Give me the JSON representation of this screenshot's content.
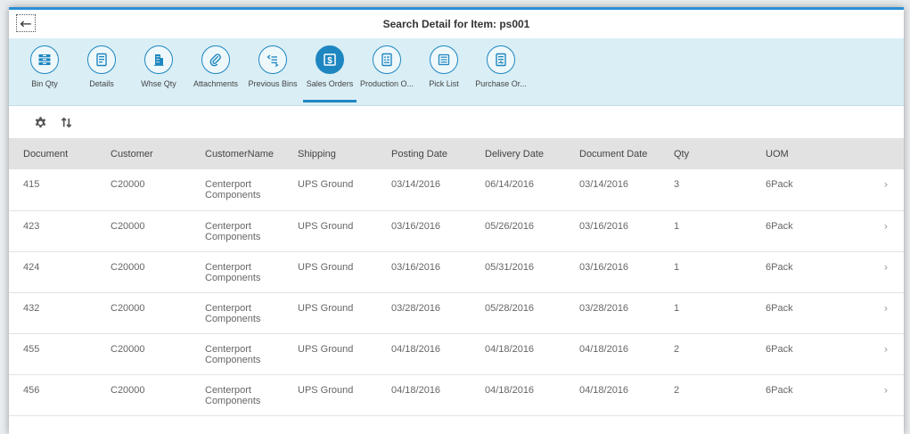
{
  "window": {
    "title": "Search Detail for Item: ps001"
  },
  "toolbar": {
    "back_icon": "arrow-left-icon",
    "tabs": [
      {
        "label": "Bin Qty",
        "icon": "bin-stack-icon"
      },
      {
        "label": "Details",
        "icon": "details-doc-icon"
      },
      {
        "label": "Whse Qty",
        "icon": "warehouse-building-icon"
      },
      {
        "label": "Attachments",
        "icon": "paperclip-icon"
      },
      {
        "label": "Previous Bins",
        "icon": "previous-list-icon"
      },
      {
        "label": "Sales Orders",
        "icon": "dollar-doc-icon",
        "active": true
      },
      {
        "label": "Production O...",
        "icon": "production-doc-icon"
      },
      {
        "label": "Pick List",
        "icon": "list-icon"
      },
      {
        "label": "Purchase Or...",
        "icon": "purchase-doc-icon"
      }
    ]
  },
  "tools": {
    "settings_icon": "gear-icon",
    "sort_icon": "sort-arrows-icon"
  },
  "table": {
    "columns": [
      "Document",
      "Customer",
      "CustomerName",
      "Shipping",
      "Posting Date",
      "Delivery Date",
      "Document Date",
      "Qty",
      "UOM"
    ],
    "rows": [
      {
        "document": "415",
        "customer": "C20000",
        "customer_name_1": "Centerport",
        "customer_name_2": "Components",
        "shipping": "UPS Ground",
        "posting_date": "03/14/2016",
        "delivery_date": "06/14/2016",
        "document_date": "03/14/2016",
        "qty": "3",
        "uom": "6Pack"
      },
      {
        "document": "423",
        "customer": "C20000",
        "customer_name_1": "Centerport",
        "customer_name_2": "Components",
        "shipping": "UPS Ground",
        "posting_date": "03/16/2016",
        "delivery_date": "05/26/2016",
        "document_date": "03/16/2016",
        "qty": "1",
        "uom": "6Pack"
      },
      {
        "document": "424",
        "customer": "C20000",
        "customer_name_1": "Centerport",
        "customer_name_2": "Components",
        "shipping": "UPS Ground",
        "posting_date": "03/16/2016",
        "delivery_date": "05/31/2016",
        "document_date": "03/16/2016",
        "qty": "1",
        "uom": "6Pack"
      },
      {
        "document": "432",
        "customer": "C20000",
        "customer_name_1": "Centerport",
        "customer_name_2": "Components",
        "shipping": "UPS Ground",
        "posting_date": "03/28/2016",
        "delivery_date": "05/28/2016",
        "document_date": "03/28/2016",
        "qty": "1",
        "uom": "6Pack"
      },
      {
        "document": "455",
        "customer": "C20000",
        "customer_name_1": "Centerport",
        "customer_name_2": "Components",
        "shipping": "UPS Ground",
        "posting_date": "04/18/2016",
        "delivery_date": "04/18/2016",
        "document_date": "04/18/2016",
        "qty": "2",
        "uom": "6Pack"
      },
      {
        "document": "456",
        "customer": "C20000",
        "customer_name_1": "Centerport",
        "customer_name_2": "Components",
        "shipping": "UPS Ground",
        "posting_date": "04/18/2016",
        "delivery_date": "04/18/2016",
        "document_date": "04/18/2016",
        "qty": "2",
        "uom": "6Pack"
      }
    ],
    "row_chevron": "›"
  },
  "colors": {
    "accent": "#1e86c0",
    "toolbar_bg": "#d9eef5",
    "header_bg": "#e2e2e2",
    "top_border": "#2a8fd4"
  }
}
